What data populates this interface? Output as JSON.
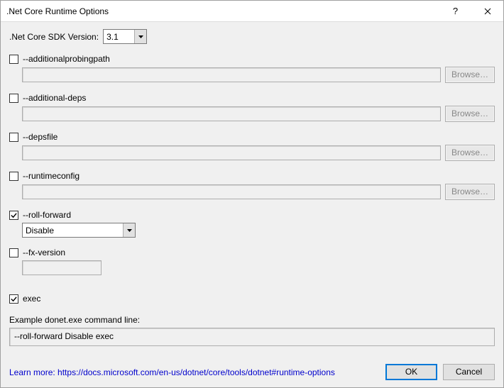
{
  "title": ".Net Core Runtime Options",
  "sdk": {
    "label": ".Net Core SDK Version:",
    "selected": "3.1"
  },
  "options": {
    "additionalprobingpath": {
      "label": "--additionalprobingpath",
      "checked": false,
      "browse": "Browse…"
    },
    "additional_deps": {
      "label": "--additional-deps",
      "checked": false,
      "browse": "Browse…"
    },
    "depsfile": {
      "label": "--depsfile",
      "checked": false,
      "browse": "Browse…"
    },
    "runtimeconfig": {
      "label": "--runtimeconfig",
      "checked": false,
      "browse": "Browse…"
    },
    "roll_forward": {
      "label": "--roll-forward",
      "checked": true,
      "value": "Disable"
    },
    "fx_version": {
      "label": "--fx-version",
      "checked": false,
      "value": ""
    },
    "exec": {
      "label": "exec",
      "checked": true
    }
  },
  "example": {
    "label": "Example donet.exe command line:",
    "value": "--roll-forward Disable exec"
  },
  "learn_more": {
    "prefix": "Learn more: ",
    "url_text": "https://docs.microsoft.com/en-us/dotnet/core/tools/dotnet#runtime-options"
  },
  "buttons": {
    "ok": "OK",
    "cancel": "Cancel"
  }
}
